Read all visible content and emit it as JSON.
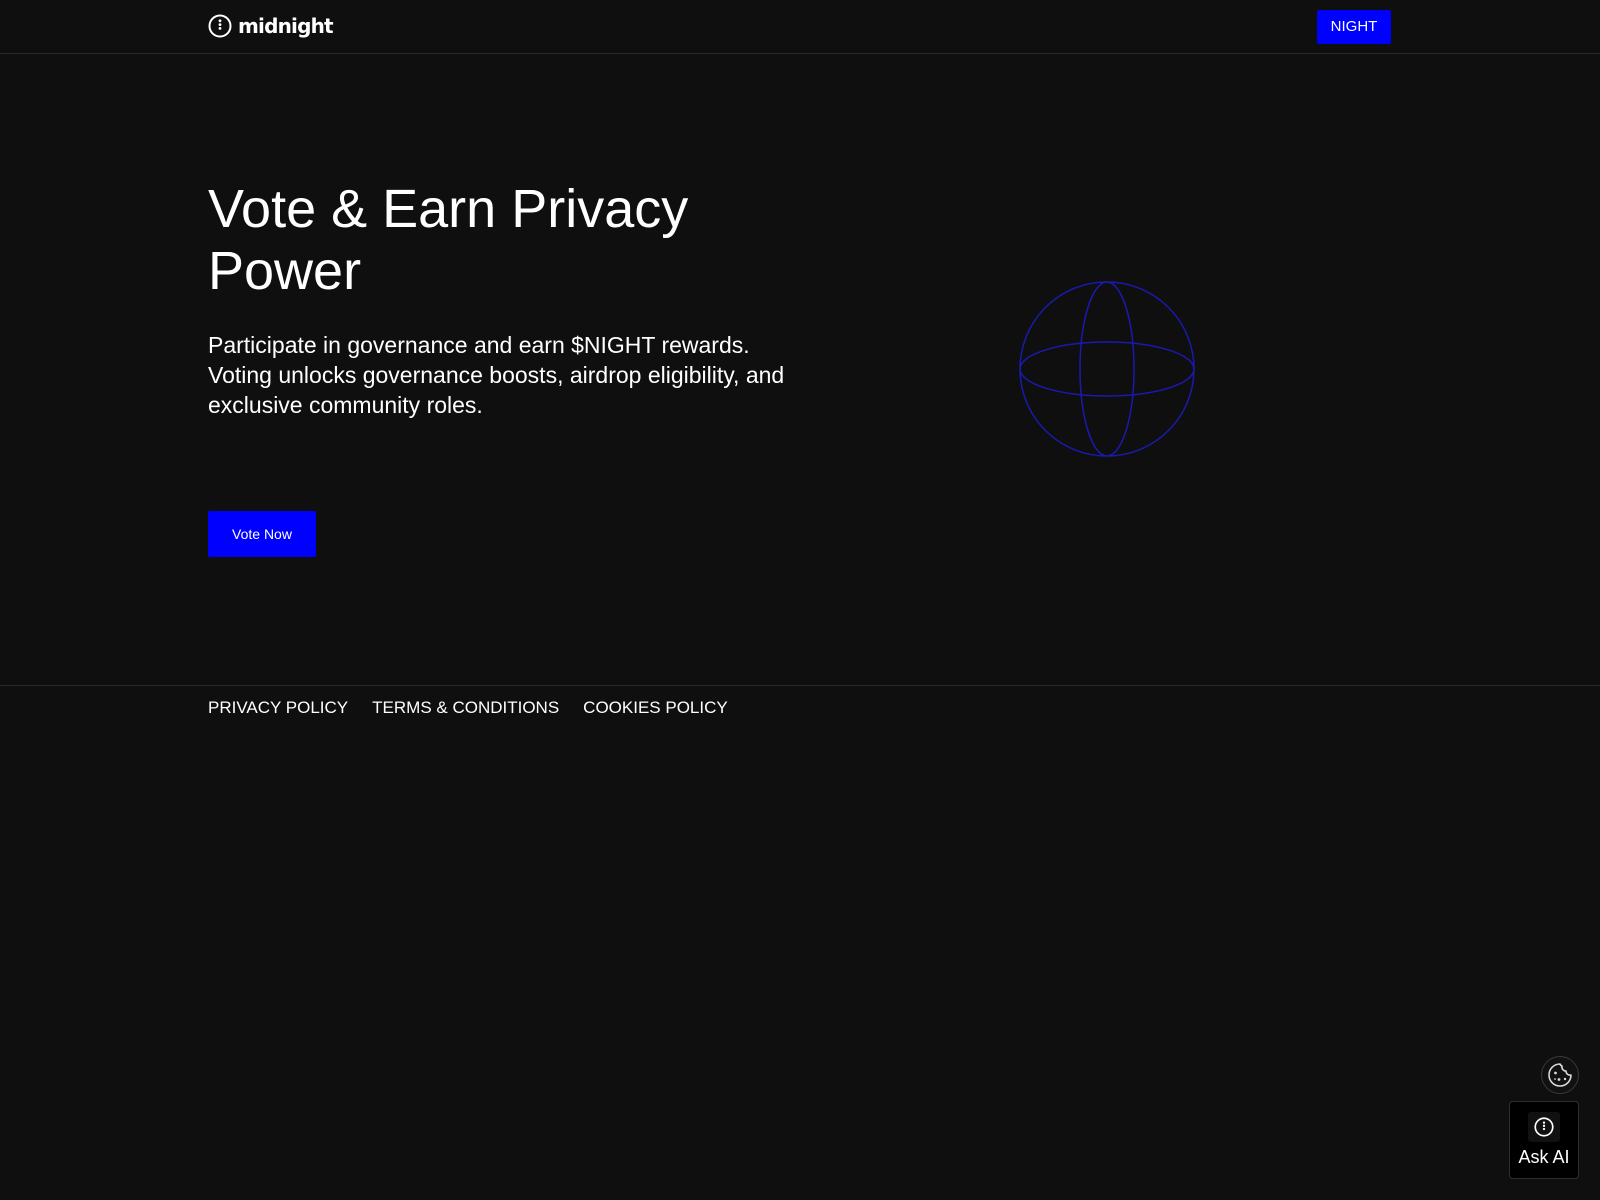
{
  "header": {
    "logo_text": "midnight",
    "night_button_label": "NIGHT"
  },
  "hero": {
    "title": "Vote & Earn Privacy Power",
    "description": "Participate in governance and earn $NIGHT rewards. Voting unlocks governance boosts, airdrop eligibility, and exclusive community roles.",
    "cta_label": "Vote Now",
    "illustration_icon": "globe-wireframe-icon"
  },
  "footer": {
    "links": [
      {
        "label": "PRIVACY POLICY"
      },
      {
        "label": "TERMS & CONDITIONS"
      },
      {
        "label": "COOKIES POLICY"
      }
    ]
  },
  "widgets": {
    "cookie_icon": "cookie-icon",
    "ask_ai_label": "Ask AI",
    "ask_ai_icon": "midnight-logo-icon"
  },
  "colors": {
    "background": "#0f0f0f",
    "accent": "#0000ff",
    "globe_stroke": "#1a1ab0",
    "text": "#ffffff",
    "divider": "#2a2a2a"
  }
}
